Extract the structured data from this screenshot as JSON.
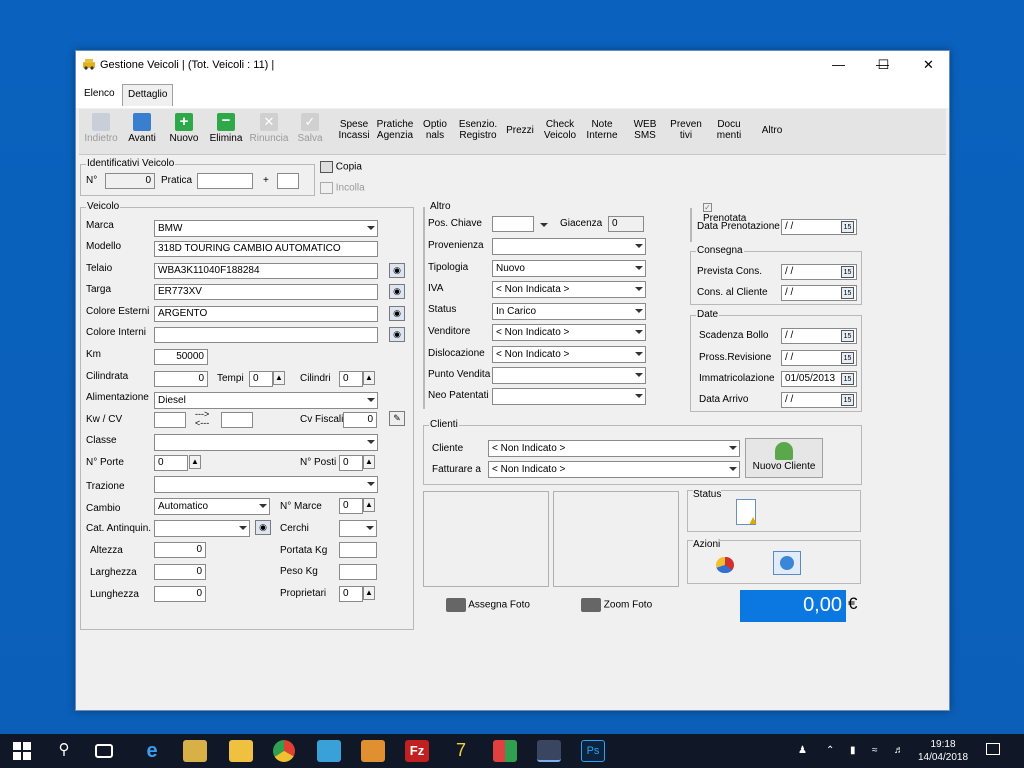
{
  "window": {
    "title": "Gestione Veicoli | (Tot. Veicoli : 11) |"
  },
  "tabs": [
    "Elenco",
    "Dettaglio"
  ],
  "toolbar": {
    "nav": [
      {
        "label": "Indietro",
        "enabled": false
      },
      {
        "label": "Avanti",
        "enabled": true
      },
      {
        "label": "Nuovo",
        "enabled": true
      },
      {
        "label": "Elimina",
        "enabled": true
      },
      {
        "label": "Rinuncia",
        "enabled": false
      },
      {
        "label": "Salva",
        "enabled": false
      }
    ],
    "text": [
      [
        "Spese",
        "Incassi"
      ],
      [
        "Pratiche",
        "Agenzia"
      ],
      [
        "Optio",
        "nals"
      ],
      [
        "Esenzio.",
        "Registro"
      ],
      [
        "Prezzi",
        ""
      ],
      [
        "Check",
        "Veicolo"
      ],
      [
        "Note",
        "Interne"
      ],
      [
        "WEB",
        "SMS"
      ],
      [
        "Preven",
        "tivi"
      ],
      [
        "Docu",
        "menti"
      ],
      [
        "Altro",
        ""
      ]
    ]
  },
  "identificativi": {
    "title": "Identificativi Veicolo",
    "no_label": "N°",
    "no_value": "0",
    "pratica_label": "Pratica",
    "pratica_value": "",
    "plus": "+",
    "suffix": ""
  },
  "copia": "Copia",
  "incolla": "Incolla",
  "veicolo": {
    "title": "Veicolo",
    "marca_label": "Marca",
    "marca": "BMW",
    "modello_label": "Modello",
    "modello": "318D TOURING CAMBIO AUTOMATICO",
    "telaio_label": "Telaio",
    "telaio": "WBA3K11040F188284",
    "targa_label": "Targa",
    "targa": "ER773XV",
    "colest_label": "Colore Esterni",
    "colest": "ARGENTO",
    "colint_label": "Colore Interni",
    "colint": "",
    "km_label": "Km",
    "km": "50000",
    "cil_label": "Cilindrata",
    "cil": "0",
    "tempi_label": "Tempi",
    "tempi": "0",
    "cilindri_label": "Cilindri",
    "cilindri": "0",
    "alim_label": "Alimentazione",
    "alim": "Diesel",
    "kw_label": "Kw / CV",
    "arrow1": "--->",
    "arrow2": "<---",
    "cvf_label": "Cv Fiscali",
    "cvf": "0",
    "classe_label": "Classe",
    "porte_label": "N° Porte",
    "porte": "0",
    "posti_label": "N° Posti",
    "posti": "0",
    "trazione_label": "Trazione",
    "cambio_label": "Cambio",
    "cambio": "Automatico",
    "marce_label": "N° Marce",
    "marce": "0",
    "catant_label": "Cat. Antinquin.",
    "cerchi_label": "Cerchi",
    "altezza_label": "Altezza",
    "altezza": "0",
    "portata_label": "Portata Kg",
    "larghezza_label": "Larghezza",
    "larghezza": "0",
    "peso_label": "Peso Kg",
    "lunghezza_label": "Lunghezza",
    "lunghezza": "0",
    "proprietari_label": "Proprietari",
    "proprietari": "0"
  },
  "altro": {
    "title": "Altro",
    "poschiave_label": "Pos. Chiave",
    "giacenza_label": "Giacenza",
    "giacenza": "0",
    "provenienza_label": "Provenienza",
    "tipologia_label": "Tipologia",
    "tipologia": "Nuovo",
    "iva_label": "IVA",
    "iva": "< Non Indicata >",
    "status_label": "Status",
    "status": "In Carico",
    "venditore_label": "Venditore",
    "venditore": "< Non Indicato >",
    "dislocazione_label": "Dislocazione",
    "dislocazione": "< Non Indicato >",
    "puntovendita_label": "Punto Vendita",
    "neopat_label": "Neo Patentati"
  },
  "prenotata": {
    "label": "Prenotata",
    "checked": true,
    "data_label": "Data Prenotazione",
    "data": "/ /"
  },
  "consegna": {
    "title": "Consegna",
    "prevista_label": "Prevista Cons.",
    "prevista": "/ /",
    "cliente_label": "Cons. al Cliente",
    "cliente": "/ /"
  },
  "date": {
    "title": "Date",
    "bollo_label": "Scadenza Bollo",
    "bollo": "/ /",
    "revisione_label": "Pross.Revisione",
    "revisione": "/ /",
    "immatr_label": "Immatricolazione",
    "immatr": "01/05/2013",
    "arrivo_label": "Data Arrivo",
    "arrivo": "/ /"
  },
  "clienti": {
    "title": "Clienti",
    "cliente_label": "Cliente",
    "cliente": "< Non Indicato >",
    "fatturare_label": "Fatturare a",
    "fatturare": "< Non Indicato >",
    "nuovo": "Nuovo Cliente"
  },
  "status_title": "Status",
  "azioni_title": "Azioni",
  "assegna": "Assegna Foto",
  "zoom": "Zoom Foto",
  "total": {
    "value": "0,00",
    "currency": "€"
  },
  "taskbar": {
    "time": "19:18",
    "date": "14/04/2018"
  },
  "colors": {
    "accent": "#0a78e0",
    "desktop": "#0b63bf",
    "taskbar": "#101828"
  }
}
